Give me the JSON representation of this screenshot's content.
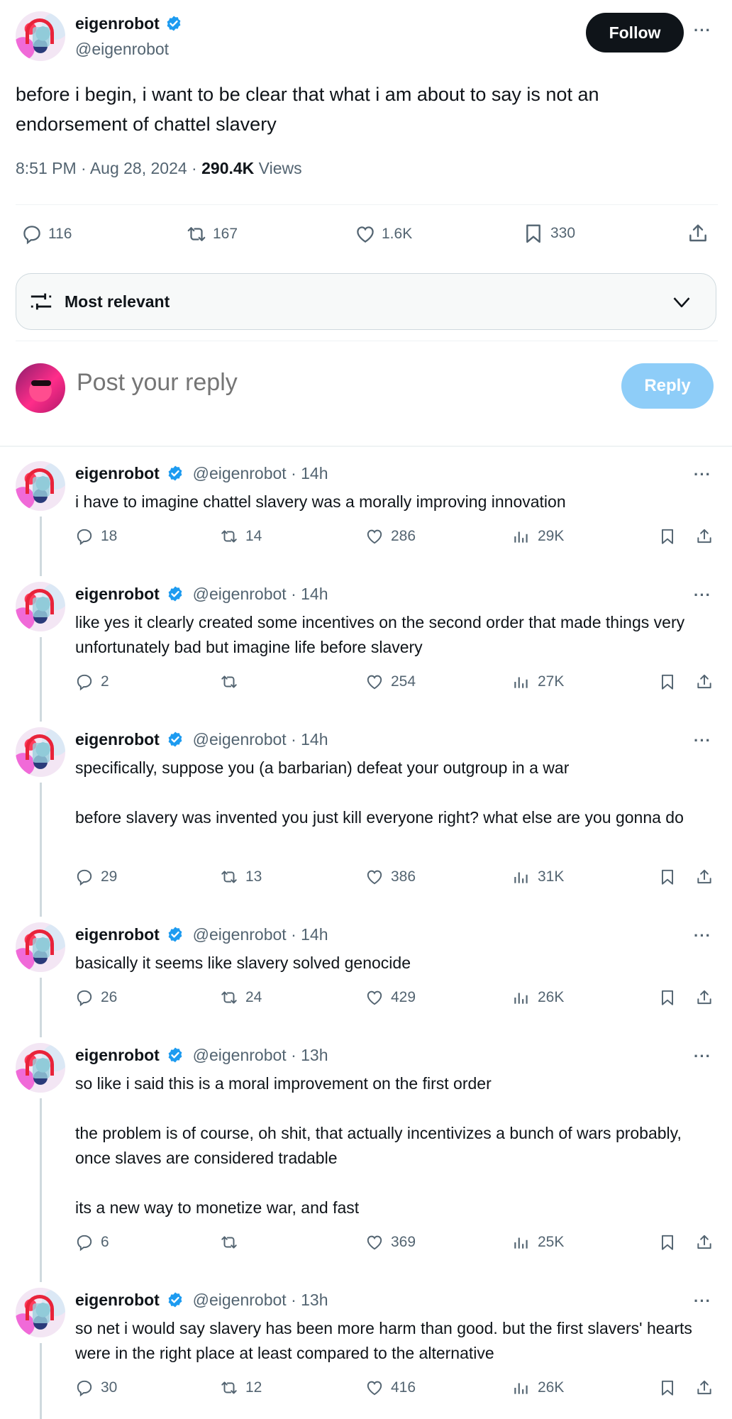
{
  "main_tweet": {
    "author_name": "eigenrobot",
    "author_handle": "@eigenrobot",
    "follow_label": "Follow",
    "more_label": "···",
    "text": "before i begin, i want to be clear that what i am about to say is not an endorsement of chattel slavery",
    "time": "8:51 PM · Aug 28, 2024 · ",
    "views_count": "290.4K",
    "views_label": " Views",
    "stats": {
      "replies": "116",
      "reposts": "167",
      "likes": "1.6K",
      "bookmarks": "330"
    }
  },
  "sort": {
    "label": "Most relevant"
  },
  "composer": {
    "placeholder": "Post your reply",
    "reply_label": "Reply"
  },
  "colors": {
    "verified": "#1d9bf0",
    "reply_button": "#8ecdf8",
    "follow_button": "#0f1419",
    "secondary_text": "#536471"
  },
  "replies": [
    {
      "name": "eigenrobot",
      "handle": "@eigenrobot",
      "time": " · 14h",
      "text": "i have to imagine chattel slavery was a morally improving innovation",
      "replies": "18",
      "reposts": "14",
      "likes": "286",
      "views": "29K"
    },
    {
      "name": "eigenrobot",
      "handle": "@eigenrobot",
      "time": " · 14h",
      "text": "like yes it clearly created some incentives on the second order that made things very unfortunately bad but imagine life before slavery",
      "replies": "2",
      "reposts": "",
      "likes": "254",
      "views": "27K"
    },
    {
      "name": "eigenrobot",
      "handle": "@eigenrobot",
      "time": " · 14h",
      "text": "specifically, suppose you (a barbarian) defeat your outgroup in a war\n\nbefore slavery was invented you just kill everyone right? what else are you gonna do",
      "replies": "29",
      "reposts": "13",
      "likes": "386",
      "views": "31K"
    },
    {
      "name": "eigenrobot",
      "handle": "@eigenrobot",
      "time": " · 14h",
      "text": "basically it seems like slavery solved genocide",
      "replies": "26",
      "reposts": "24",
      "likes": "429",
      "views": "26K"
    },
    {
      "name": "eigenrobot",
      "handle": "@eigenrobot",
      "time": " · 13h",
      "text": "so like i said this is a moral improvement on the first order\n\nthe problem is of course, oh shit, that actually incentivizes a bunch of wars probably, once slaves are considered tradable\n\nits a new way to monetize war, and fast",
      "replies": "6",
      "reposts": "",
      "likes": "369",
      "views": "25K"
    },
    {
      "name": "eigenrobot",
      "handle": "@eigenrobot",
      "time": " · 13h",
      "text": "so net i would say slavery has been more harm than good. but the first slavers' hearts were in the right place at least compared to the alternative",
      "replies": "30",
      "reposts": "12",
      "likes": "416",
      "views": "26K"
    }
  ]
}
